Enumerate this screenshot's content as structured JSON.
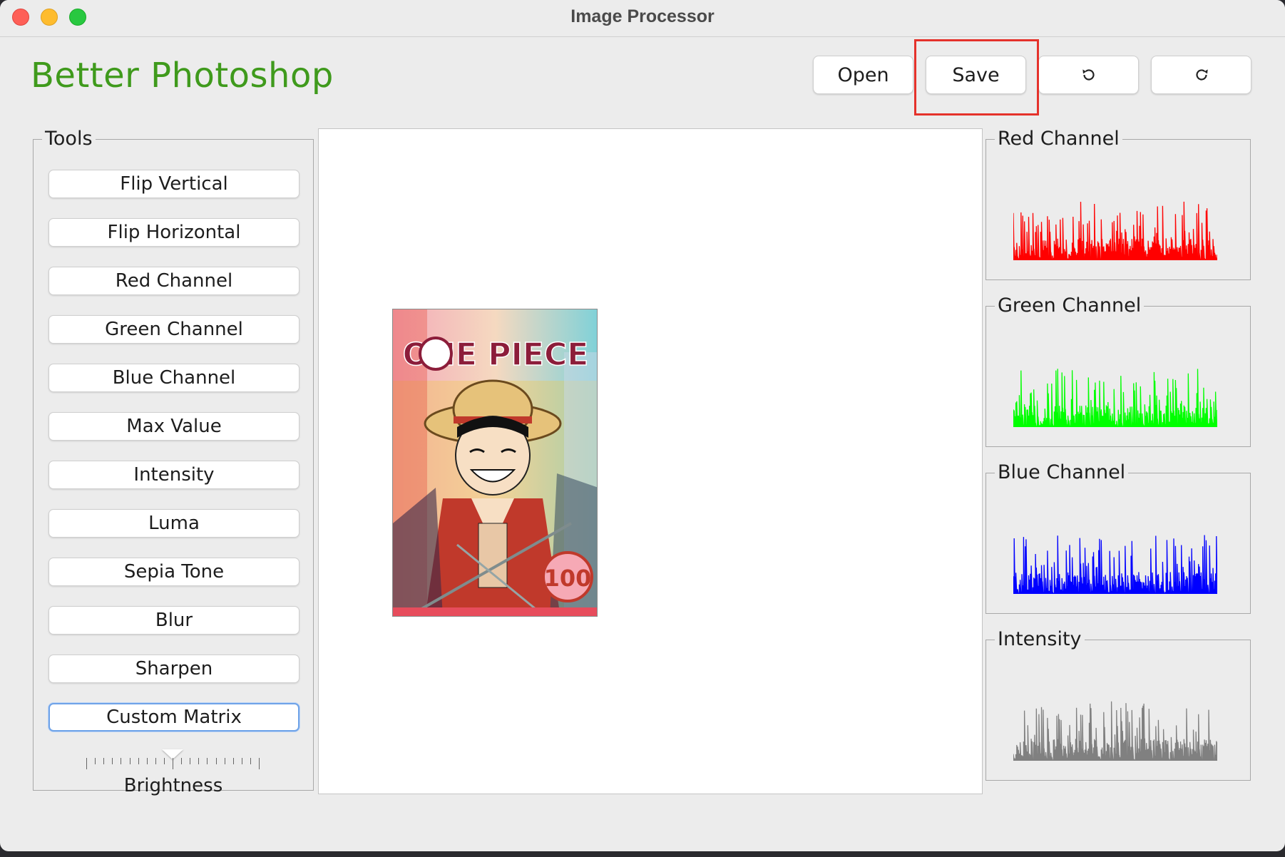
{
  "window": {
    "title": "Image Processor"
  },
  "app": {
    "title": "Better Photoshop"
  },
  "toolbar": {
    "open_label": "Open",
    "save_label": "Save",
    "undo_icon": "undo-icon",
    "redo_icon": "redo-icon"
  },
  "tools": {
    "legend": "Tools",
    "buttons": [
      "Flip Vertical",
      "Flip Horizontal",
      "Red Channel",
      "Green Channel",
      "Blue Channel",
      "Max Value",
      "Intensity",
      "Luma",
      "Sepia Tone",
      "Blur",
      "Sharpen",
      "Custom Matrix"
    ],
    "slider_label": "Brightness",
    "slider_value_fraction": 0.5
  },
  "canvas": {
    "image": "one-piece-volume-100-cover",
    "cover_title": "ONE PIECE",
    "cover_number": "100"
  },
  "histograms": [
    {
      "label": "Red Channel",
      "color": "#ff0000"
    },
    {
      "label": "Green Channel",
      "color": "#00ff00"
    },
    {
      "label": "Blue Channel",
      "color": "#0000ff"
    },
    {
      "label": "Intensity",
      "color": "#808080"
    }
  ],
  "colors": {
    "accent_green": "#3f9a1c",
    "highlight_red": "#e5322b"
  }
}
